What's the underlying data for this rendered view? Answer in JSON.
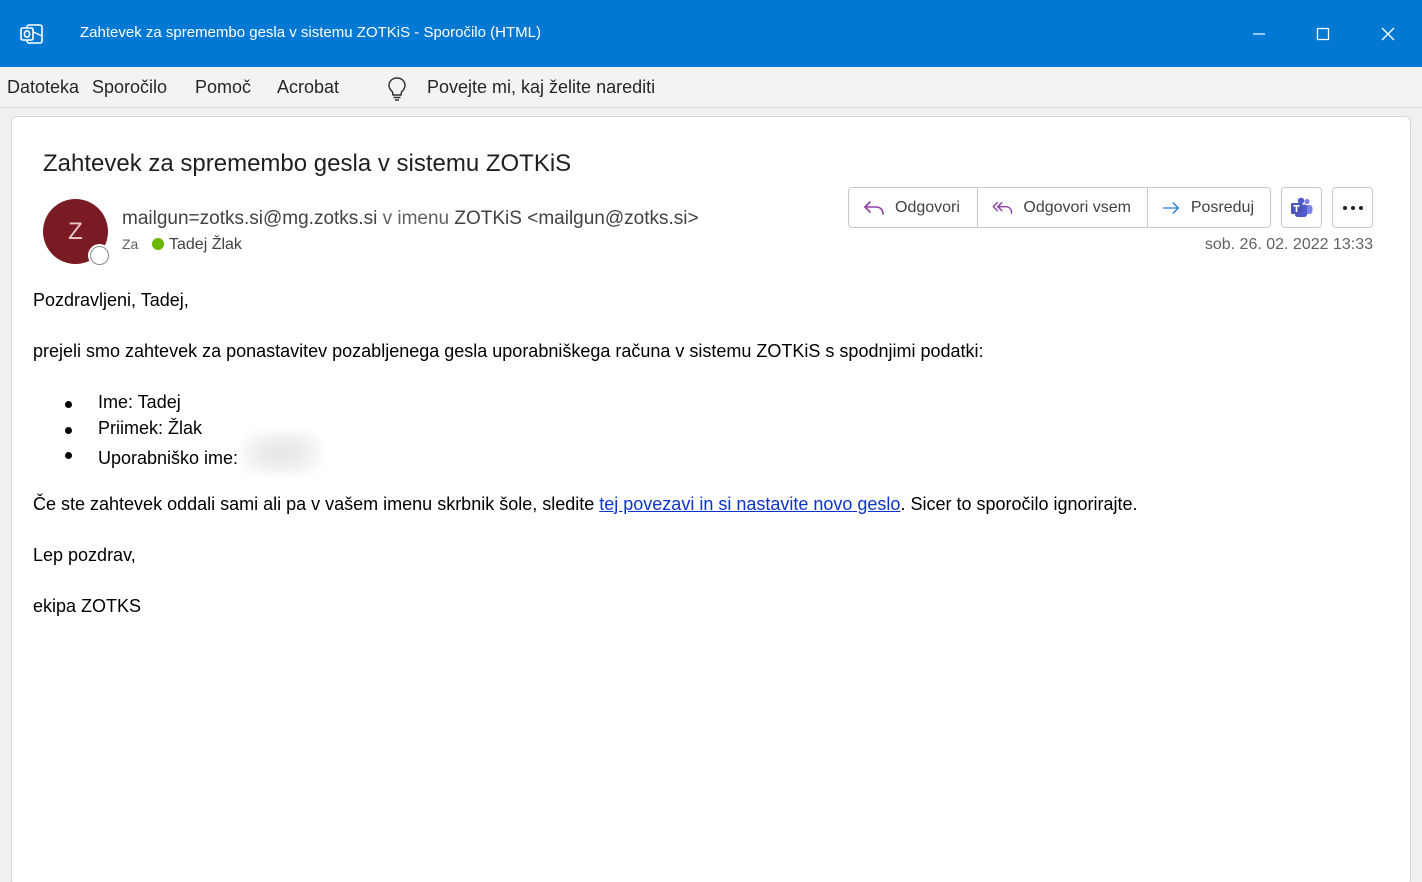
{
  "window": {
    "title": "Zahtevek za spremembo gesla v sistemu ZOTKiS  -  Sporočilo (HTML)",
    "accent_color": "#0078d4",
    "controls": {
      "minimize": "minimize-icon",
      "maximize": "maximize-icon",
      "close": "close-icon"
    }
  },
  "menu": {
    "items": [
      "Datoteka",
      "Sporočilo",
      "Pomoč",
      "Acrobat"
    ],
    "tell_me": "Povejte mi, kaj želite narediti"
  },
  "message": {
    "subject": "Zahtevek za spremembo gesla v sistemu ZOTKiS",
    "avatar_initial": "Z",
    "avatar_color": "#7a1a23",
    "sender_address": "mailgun=zotks.si@mg.zotks.si",
    "on_behalf": "v imenu",
    "sender_name": "ZOTKiS <mailgun@zotks.si>",
    "to_label": "Za",
    "to_name": "Tadej Žlak",
    "date": "sob. 26. 02. 2022 13:33",
    "actions": {
      "reply": "Odgovori",
      "reply_all": "Odgovori vsem",
      "forward": "Posreduj"
    }
  },
  "body": {
    "greeting": "Pozdravljeni, Tadej,",
    "intro": "prejeli smo zahtevek za ponastavitev pozabljenega gesla uporabniškega računa v sistemu ZOTKiS s spodnjimi podatki:",
    "details": [
      "Ime: Tadej",
      "Priimek: Žlak",
      "Uporabniško ime:"
    ],
    "instruction_before": "Če ste zahtevek oddali sami ali pa v vašem imenu skrbnik šole, sledite ",
    "link_text": "tej povezavi in si nastavite novo geslo",
    "instruction_after": ". Sicer to sporočilo ignorirajte.",
    "closing": "Lep pozdrav,",
    "signature": "ekipa ZOTKS"
  }
}
